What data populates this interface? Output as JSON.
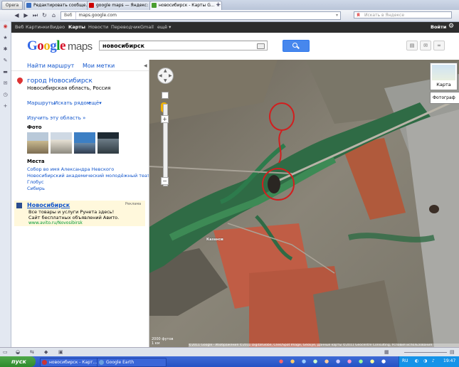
{
  "browser": {
    "menu_label": "Opera",
    "tabs": [
      {
        "label": "Редактировать сообще...",
        "favicon_color": "#3a6fc2"
      },
      {
        "label": "google maps — Яндекс: ...",
        "favicon_color": "#cc0000"
      },
      {
        "label": "новосибирск - Карты G...",
        "favicon_color": "#4a9e2f"
      }
    ],
    "address_prefix": "Веб",
    "url": "maps.google.com",
    "search_placeholder": "Искать в Яндексе",
    "search_engine_letter": "Я"
  },
  "gbar": {
    "items": [
      "Веб",
      "Картинки",
      "Видео",
      "Карты",
      "Новости",
      "Переводчик",
      "Gmail",
      "ещё ▾"
    ],
    "active": "Карты",
    "signin": "Войти"
  },
  "header": {
    "logo_letters": [
      "G",
      "o",
      "o",
      "g",
      "l",
      "e"
    ],
    "logo_colors": [
      "#3369e8",
      "#d50f25",
      "#eeb211",
      "#3369e8",
      "#009925",
      "#d50f25"
    ],
    "logo_suffix": "maps",
    "query": "новосибирск"
  },
  "side": {
    "top_links": [
      "Найти маршрут",
      "Мои метки"
    ],
    "place_title": "город Новосибирск",
    "place_subtitle": "Новосибирская область, Россия",
    "actions": [
      "Маршруты",
      "Искать рядом",
      "ещё▾"
    ],
    "explore": "Изучить эту область »",
    "photos_heading": "Фото",
    "places_heading": "Места",
    "places": [
      "Собор во имя Александра Невского",
      "Новосибирский академический молодёжный театр",
      "Глобус",
      "Сибирь"
    ],
    "ad": {
      "title": "Новосибирск",
      "badge": "Реклама",
      "line1": "Все товары и услуги Рунета здесь!",
      "line2": "Сайт бесплатных объявлений Авито.",
      "url": "www.avito.ru/Novosibirsk"
    }
  },
  "map": {
    "type_label": "Карта",
    "photo_label": "Фотограф",
    "place_label": "Казанов",
    "scale": "2000 футов",
    "scale2": "1 км",
    "copyright": "©2011 Google - Изображения ©2011 DigitalGlobe, Cnes/Spot Image, GeoEye, Данные карты ©2011 Geocentre Consulting, Условия использования"
  },
  "taskbar": {
    "start": "пуск",
    "tasks": [
      "новосибирск - Карт...",
      "Google Earth"
    ],
    "lang": "RU",
    "clock": "19:47"
  }
}
